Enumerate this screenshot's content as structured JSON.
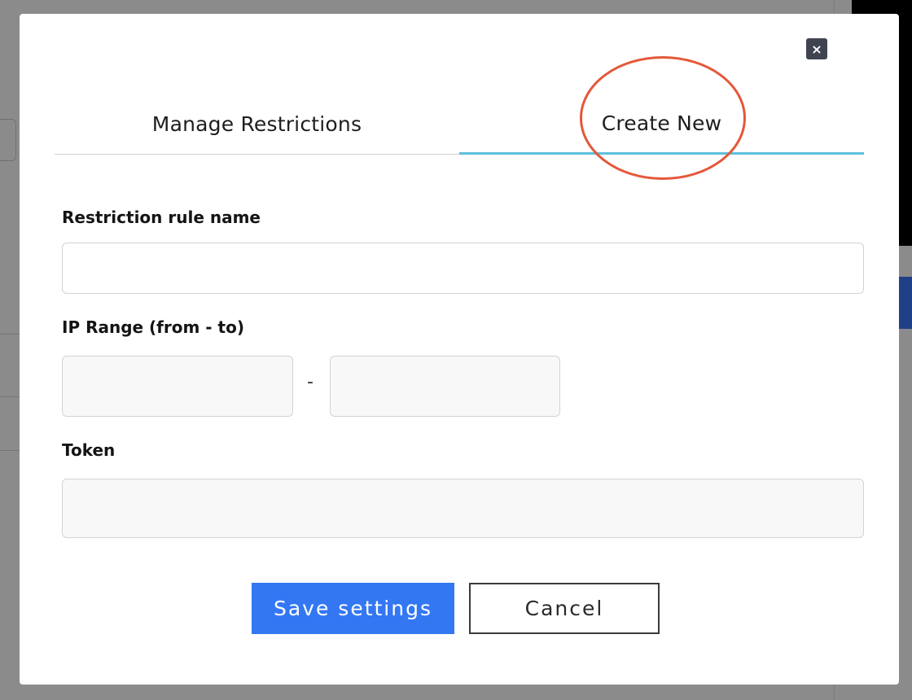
{
  "modal": {
    "close_symbol": "×",
    "tabs": [
      {
        "label": "Manage Restrictions",
        "active": false
      },
      {
        "label": "Create New",
        "active": true
      }
    ],
    "form": {
      "rule_name_label": "Restriction rule name",
      "rule_name_value": "",
      "ip_range_label": "IP Range (from - to)",
      "ip_from_value": "",
      "ip_separator": "-",
      "ip_to_value": "",
      "token_label": "Token",
      "token_value": ""
    },
    "buttons": {
      "save_label": "Save settings",
      "cancel_label": "Cancel"
    }
  },
  "colors": {
    "accent_blue": "#3377f3",
    "active_tab_underline": "#5fbfdc",
    "highlight_annotation": "#e4583a",
    "close_button_bg": "#3f4450"
  },
  "icons": {
    "close": "close-icon"
  }
}
